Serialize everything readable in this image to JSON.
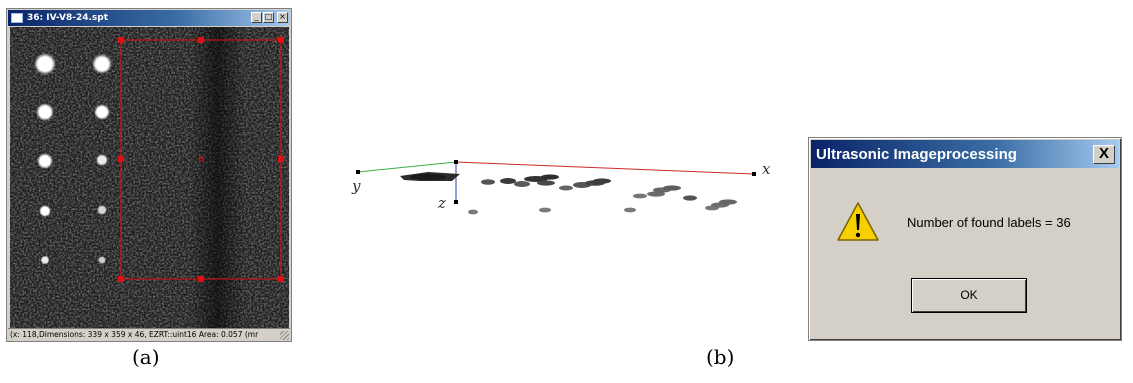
{
  "viewer": {
    "title": "36: IV-V8-24.spt",
    "minimize_label": "_",
    "maximize_label": "□",
    "close_label": "×",
    "status": "(x: 118,Dimensions: 339 x 359 x 46, EZRT::uint16  Area: 0.057 (mr"
  },
  "captions": {
    "a": "(a)",
    "b": "(b)"
  },
  "plot": {
    "axis_x": "x",
    "axis_y": "y",
    "axis_z": "z",
    "colors": {
      "x_axis": "#cc2a2a",
      "y_axis": "#3cb043",
      "z_axis": "#2a3fb8"
    }
  },
  "dialog": {
    "title": "Ultrasonic Imageprocessing",
    "close_label": "X",
    "message": "Number of found labels = 36",
    "ok_label": "OK",
    "icon": "warning-icon"
  },
  "colors": {
    "titlebar": "#0a246a",
    "selection": "#e01010",
    "window_face": "#d4d0c8"
  }
}
